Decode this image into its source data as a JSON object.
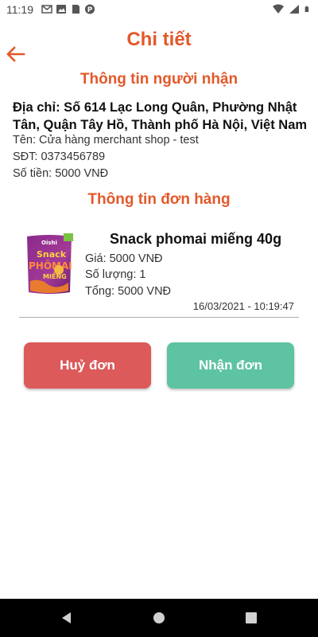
{
  "status_bar": {
    "time": "11:19"
  },
  "header": {
    "title": "Chi tiết"
  },
  "recipient": {
    "section_title": "Thông tin người nhận",
    "address": "Địa chỉ: Số 614 Lạc Long Quân, Phường Nhật Tân, Quận Tây Hồ, Thành phố Hà Nội, Việt Nam",
    "name": "Tên: Cửa hàng merchant shop - test",
    "phone": "SĐT: 0373456789",
    "amount": "Số tiền: 5000 VNĐ"
  },
  "order": {
    "section_title": "Thông tin đơn hàng",
    "product_name": "Snack phomai miếng 40g",
    "price": "Giá: 5000 VNĐ",
    "quantity": "Số lượng: 1",
    "total": "Tổng: 5000 VNĐ",
    "date": "16/03/2021 - 10:19:47",
    "image_text": {
      "brand": "Oishi",
      "line1": "Snack",
      "line2": "PHÔMAI",
      "line3": "MIẾNG"
    }
  },
  "actions": {
    "cancel_label": "Huỷ đơn",
    "receive_label": "Nhận đơn"
  },
  "colors": {
    "accent": "#e2592a",
    "cancel": "#dc5a5a",
    "receive": "#5ec3a3"
  }
}
